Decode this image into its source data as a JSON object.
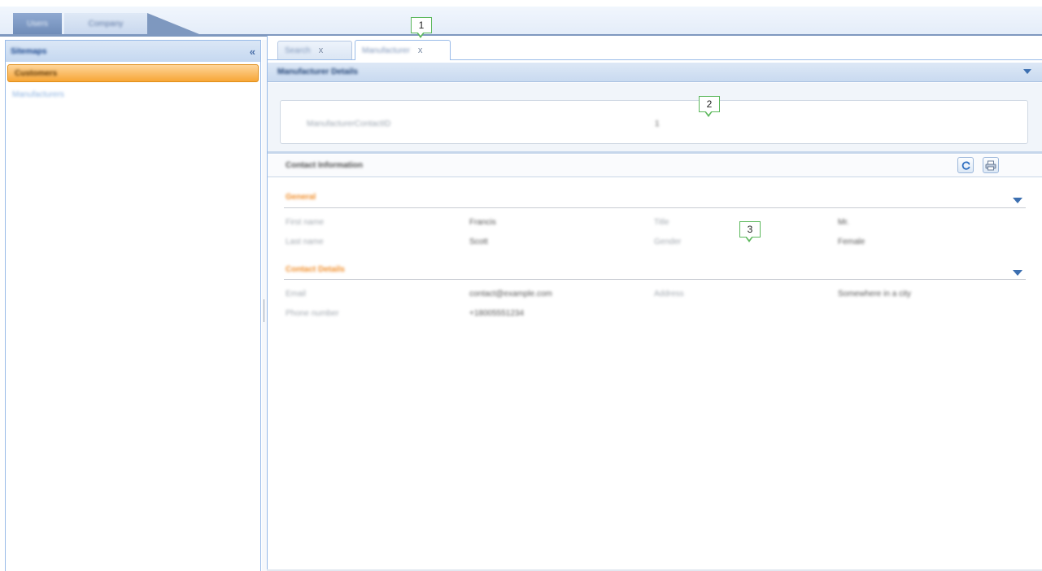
{
  "top_tabs": [
    {
      "label": "Users"
    },
    {
      "label": "Company"
    }
  ],
  "left_panel": {
    "title": "Sitemaps",
    "items": [
      {
        "label": "Customers",
        "active": true
      },
      {
        "label": "Manufacturers",
        "active": false
      }
    ]
  },
  "main_tabs": [
    {
      "label": "Search",
      "close": "x"
    },
    {
      "label": "Manufacturer",
      "close": "x"
    }
  ],
  "section1": {
    "title": "Manufacturer Details",
    "field_label": "ManufacturerContactID",
    "field_value": "1"
  },
  "section2": {
    "title": "Contact Information",
    "groups": [
      {
        "title": "General",
        "fields": [
          {
            "label": "First name",
            "value": "Francis"
          },
          {
            "label": "Title",
            "value": "Mr."
          },
          {
            "label": "Last name",
            "value": "Scott"
          },
          {
            "label": "Gender",
            "value": "Female"
          }
        ]
      },
      {
        "title": "Contact Details",
        "fields": [
          {
            "label": "Email",
            "value": "contact@example.com"
          },
          {
            "label": "Address",
            "value": "Somewhere in a city"
          },
          {
            "label": "Phone number",
            "value": "+18005551234"
          }
        ]
      }
    ]
  },
  "callouts": [
    "1",
    "2",
    "3"
  ],
  "icons": {
    "collapse": "double-chevron-left-icon",
    "refresh": "refresh-icon",
    "print": "printer-icon",
    "toggle": "triangle-down-icon"
  },
  "colors": {
    "accent_orange": "#f7a637",
    "header_blue": "#c9daf0",
    "callout_green": "#5cb85c"
  }
}
